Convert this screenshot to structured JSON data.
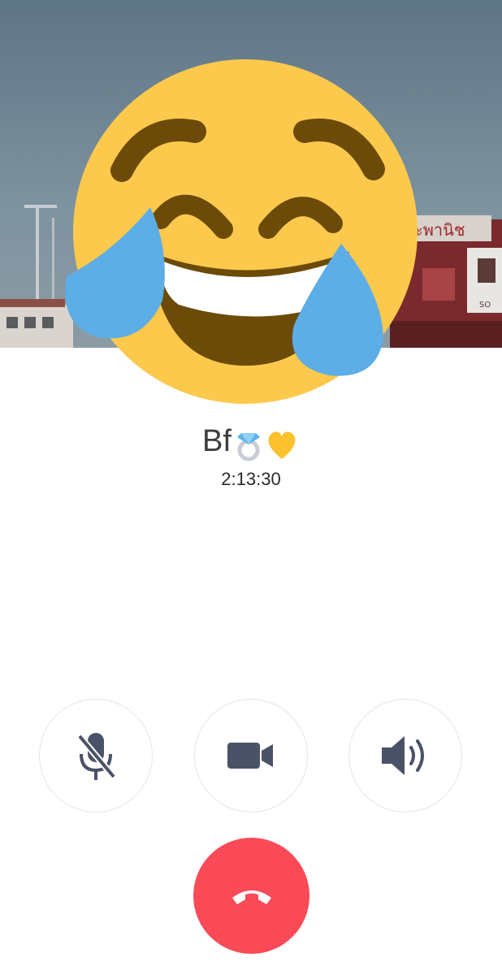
{
  "call": {
    "caller_name": "Bf",
    "name_emojis": [
      "ring-emoji",
      "yellow-heart-emoji"
    ],
    "duration": "2:13:30",
    "avatar_icon": "face-with-tears-of-joy-emoji"
  },
  "controls": {
    "mute_icon": "microphone-off-icon",
    "video_icon": "video-camera-icon",
    "speaker_icon": "speaker-icon",
    "end_call_icon": "phone-hangup-icon"
  },
  "colors": {
    "end_call": "#fa4a57",
    "icon": "#4a5268",
    "emoji_face": "#fcc94d",
    "emoji_tears": "#5dade6"
  }
}
